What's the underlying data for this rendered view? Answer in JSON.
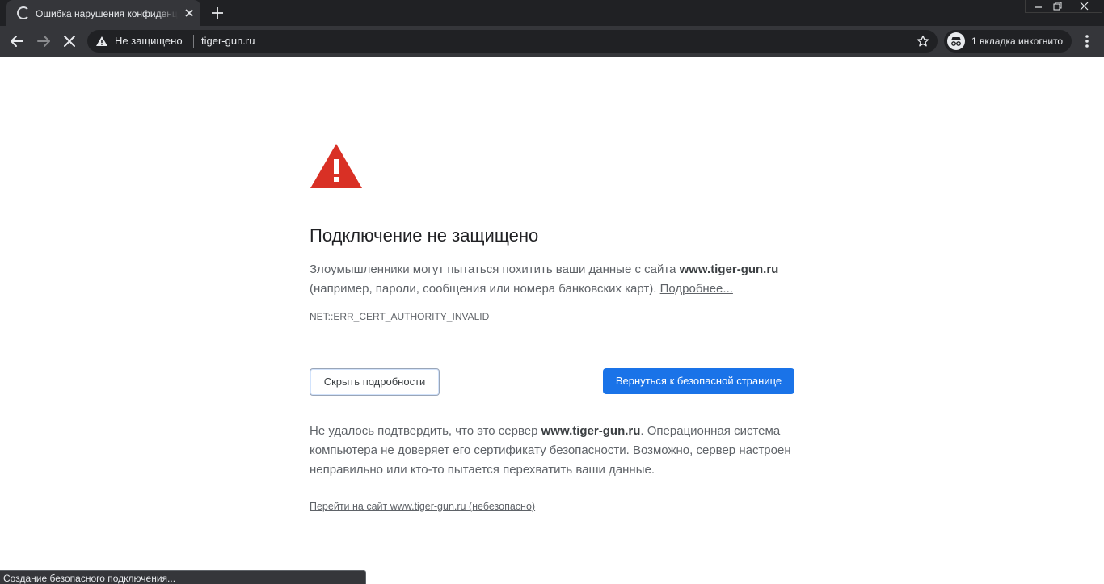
{
  "tab": {
    "title": "Ошибка нарушения конфиденциальности"
  },
  "omnibox": {
    "security_status": "Не защищено",
    "url": "tiger-gun.ru"
  },
  "incognito": {
    "label": "1 вкладка инкогнито"
  },
  "page": {
    "heading": "Подключение не защищено",
    "main_message_prefix": "Злоумышленники могут пытаться похитить ваши данные с сайта ",
    "main_message_host": "www.tiger-gun.ru",
    "main_message_suffix": " (например, пароли, сообщения или номера банковских карт). ",
    "learn_more_link": "Подробнее...",
    "error_code": "NET::ERR_CERT_AUTHORITY_INVALID",
    "details_button": "Скрыть подробности",
    "back_button": "Вернуться к безопасной странице",
    "details_prefix": "Не удалось подтвердить, что это сервер ",
    "details_host": "www.tiger-gun.ru",
    "details_suffix": ". Операционная система компьютера не доверяет его сертификату безопасности. Возможно, сервер настроен неправильно или кто-то пытается перехватить ваши данные.",
    "proceed_link": "Перейти на сайт www.tiger-gun.ru (небезопасно)"
  },
  "status_bar": {
    "text": "Создание безопасного подключения..."
  },
  "colors": {
    "chrome_dark": "#202124",
    "chrome_toolbar": "#35363a",
    "warning_red": "#d93025",
    "primary_button": "#1a73e8"
  },
  "icons": {
    "tab_loading": "loading-spinner-icon",
    "tab_close": "close-icon",
    "new_tab": "plus-icon",
    "back": "arrow-left-icon",
    "forward": "arrow-right-icon",
    "stop": "stop-icon",
    "not_secure": "warning-triangle-icon",
    "bookmark": "star-icon",
    "incognito": "incognito-icon",
    "menu": "kebab-menu-icon",
    "page_warning": "red-warning-triangle-icon"
  }
}
